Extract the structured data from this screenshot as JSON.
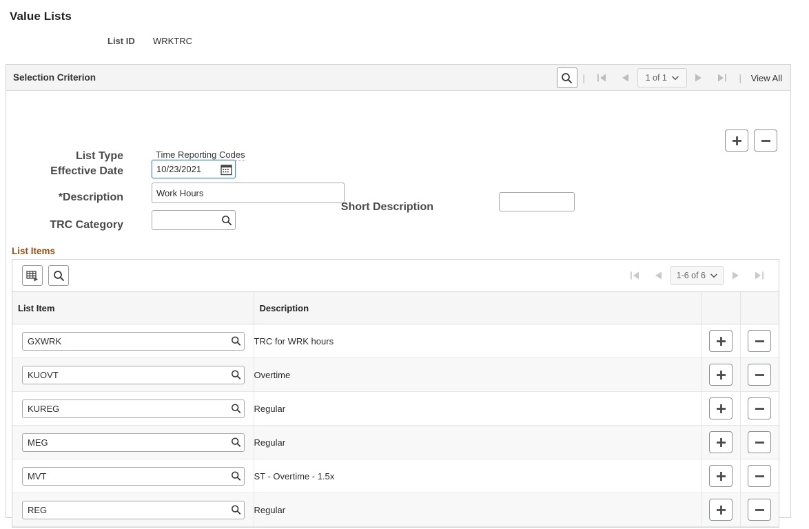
{
  "page": {
    "title": "Value Lists",
    "list_id_label": "List ID",
    "list_id_value": "WRKTRC"
  },
  "selection_criterion": {
    "header_title": "Selection Criterion",
    "nav": {
      "search_icon": "search-icon",
      "first_icon": "first-page-icon",
      "prev_icon": "previous-page-icon",
      "page_indicator": "1 of 1",
      "chevron_icon": "chevron-down-icon",
      "next_icon": "next-page-icon",
      "last_icon": "last-page-icon",
      "separator": "|",
      "view_all_label": "View All"
    },
    "row_actions": {
      "add_label": "+",
      "delete_label": "–"
    },
    "fields": {
      "list_type_label": "List Type",
      "list_type_value": "Time Reporting Codes",
      "effective_date_label": "Effective Date",
      "effective_date_value": "10/23/2021",
      "calendar_icon": "calendar-icon",
      "description_label": "*Description",
      "description_value": "Work Hours",
      "short_description_label": "Short Description",
      "short_description_value": "",
      "trc_category_label": "TRC Category",
      "trc_category_value": "",
      "lookup_icon": "lookup-search-icon"
    }
  },
  "list_items": {
    "section_title": "List Items",
    "toolbar": {
      "personalize_icon": "grid-personalize-icon",
      "find_icon": "search-icon"
    },
    "pager": {
      "first_icon": "first-page-icon",
      "prev_icon": "previous-page-icon",
      "range": "1-6 of 6",
      "chevron_icon": "chevron-down-icon",
      "next_icon": "next-page-icon",
      "last_icon": "last-page-icon"
    },
    "columns": [
      "List Item",
      "Description",
      "",
      ""
    ],
    "rows": [
      {
        "list_item": "GXWRK",
        "description": "TRC for WRK hours",
        "add": "+",
        "remove": "–"
      },
      {
        "list_item": "KUOVT",
        "description": "Overtime",
        "add": "+",
        "remove": "–"
      },
      {
        "list_item": "KUREG",
        "description": "Regular",
        "add": "+",
        "remove": "–"
      },
      {
        "list_item": "MEG",
        "description": "Regular",
        "add": "+",
        "remove": "–"
      },
      {
        "list_item": "MVT",
        "description": "ST - Overtime - 1.5x",
        "add": "+",
        "remove": "–"
      },
      {
        "list_item": "REG",
        "description": "Regular",
        "add": "+",
        "remove": "–"
      }
    ]
  },
  "colors": {
    "section_accent": "#9b4d11",
    "header_bg": "#f4f4f4",
    "focus_border": "#4a8fd4",
    "alt_row_bg": "#f8f8f8"
  }
}
